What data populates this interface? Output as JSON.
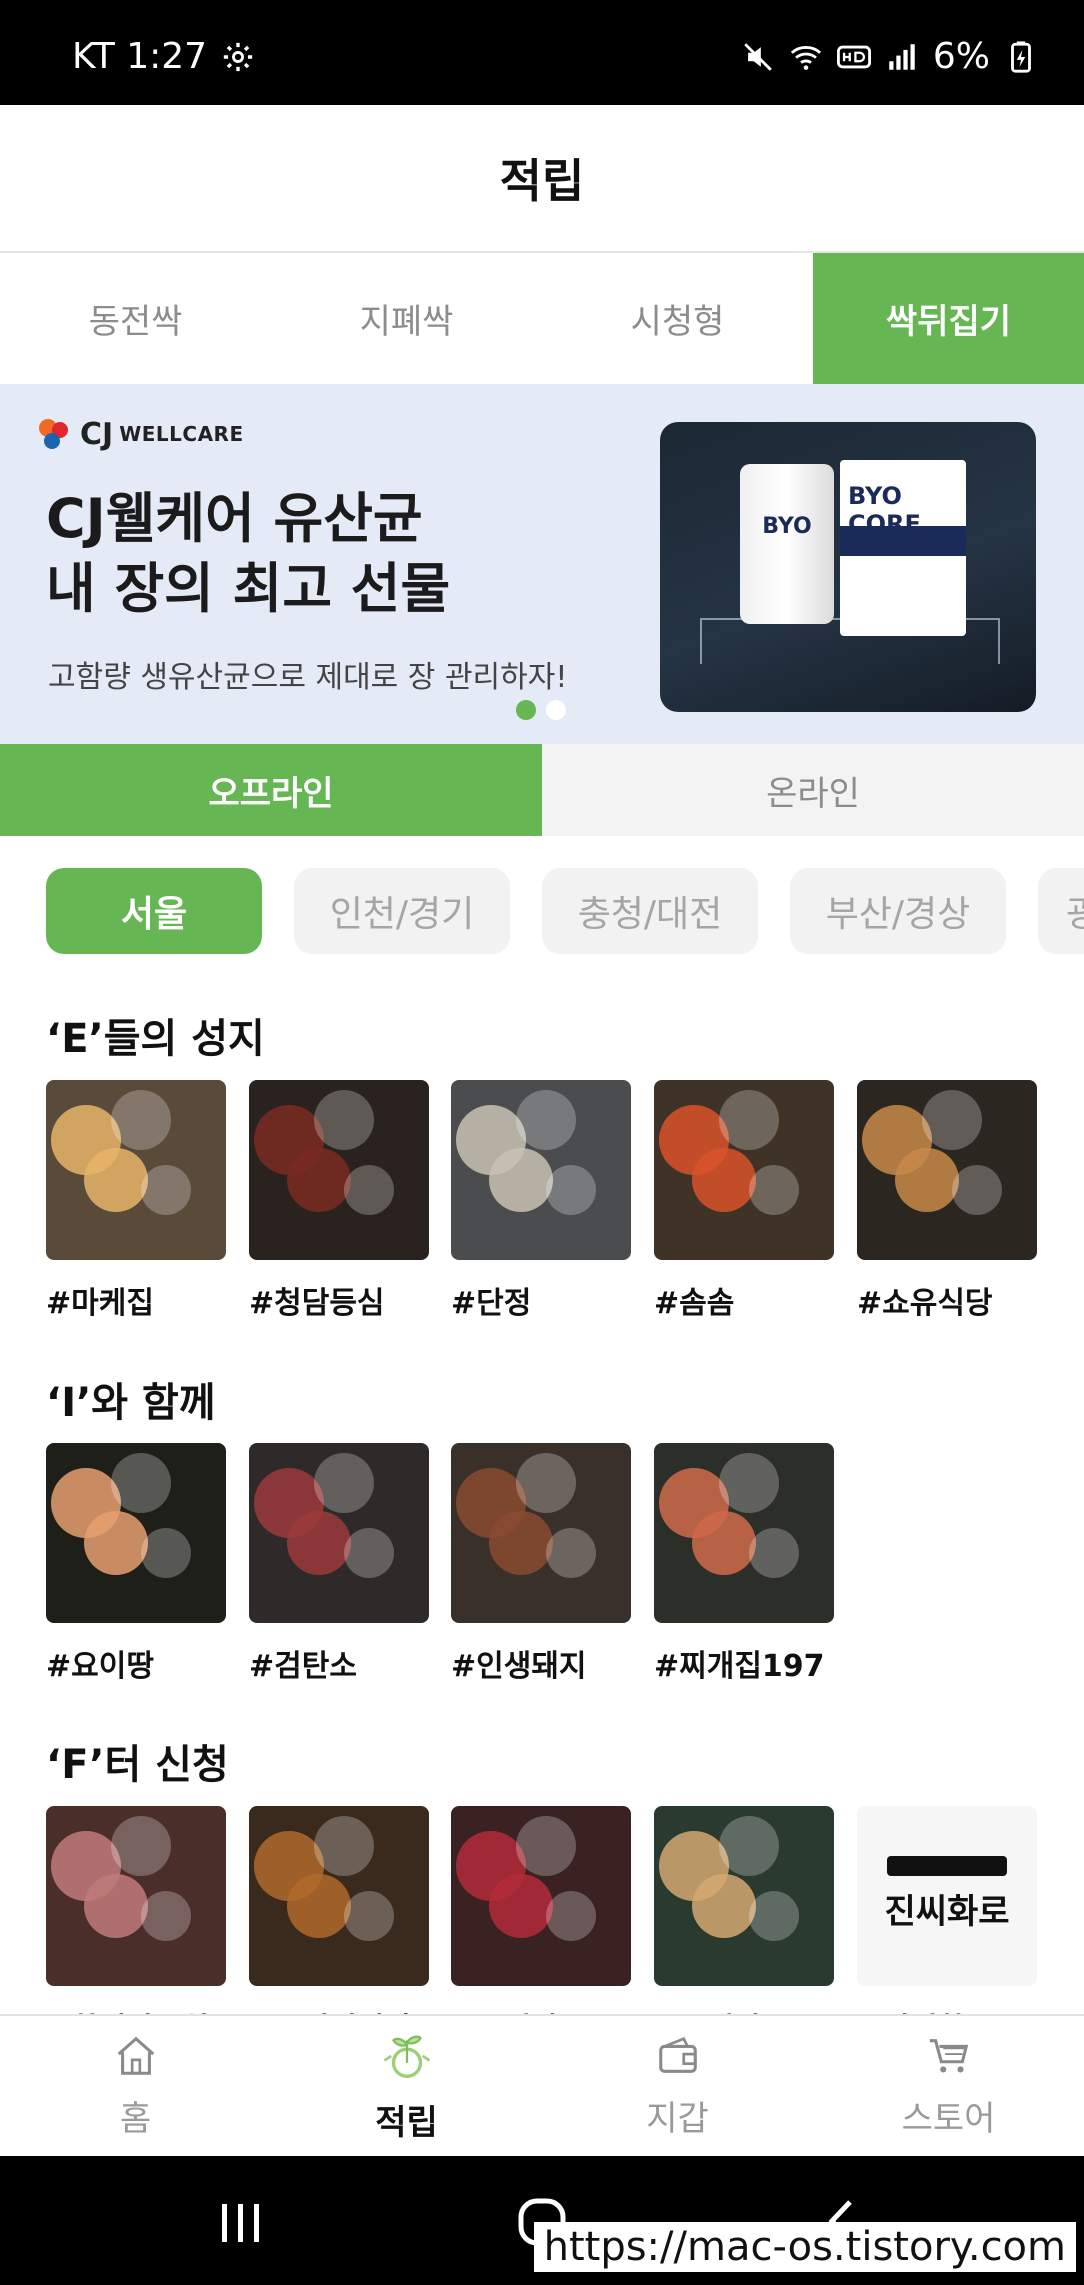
{
  "status_bar": {
    "carrier_time": "KT 1:27",
    "battery": "6%"
  },
  "header": {
    "title": "적립"
  },
  "tabs": [
    {
      "label": "동전싹",
      "active": false
    },
    {
      "label": "지폐싹",
      "active": false
    },
    {
      "label": "시청형",
      "active": false
    },
    {
      "label": "싹뒤집기",
      "active": true
    }
  ],
  "banner": {
    "logo_cj": "CJ",
    "logo_wellcare": "WELLCARE",
    "headline_line1": "CJ웰케어 유산균",
    "headline_line2": "내 장의 최고 선물",
    "subtext": "고함량 생유산균으로 제대로 장 관리하자!",
    "product_bottle_label": "BYO",
    "product_box_label": "BYO CORE"
  },
  "sub_tabs": [
    {
      "label": "오프라인",
      "active": true
    },
    {
      "label": "온라인",
      "active": false
    }
  ],
  "regions": [
    {
      "label": "서울",
      "active": true
    },
    {
      "label": "인천/경기",
      "active": false
    },
    {
      "label": "충청/대전",
      "active": false
    },
    {
      "label": "부산/경상",
      "active": false
    },
    {
      "label": "광",
      "active": false
    }
  ],
  "sections": [
    {
      "title": "‘E’들의 성지",
      "items": [
        {
          "label": "#마케집",
          "bg": "#5a4a3a",
          "accent": "#e8b46a"
        },
        {
          "label": "#청담등심",
          "bg": "#2a221e",
          "accent": "#7a2a22"
        },
        {
          "label": "#단정",
          "bg": "#4a4c4e",
          "accent": "#c9c2b4"
        },
        {
          "label": "#솜솜",
          "bg": "#3e3326",
          "accent": "#d8542a"
        },
        {
          "label": "#쇼유식당",
          "bg": "#2c2620",
          "accent": "#c8894a"
        }
      ]
    },
    {
      "title": "‘I’와 함께",
      "items": [
        {
          "label": "#요이땅",
          "bg": "#1f1f1a",
          "accent": "#e8a070"
        },
        {
          "label": "#검탄소",
          "bg": "#2e2a2a",
          "accent": "#9c3a3a"
        },
        {
          "label": "#인생돼지",
          "bg": "#3a302a",
          "accent": "#8a4a30"
        },
        {
          "label": "#찌개집197",
          "bg": "#2c2e2a",
          "accent": "#d06a4a"
        }
      ]
    },
    {
      "title": "‘F’터 신청",
      "items": [
        {
          "label": "#화서양꼬치",
          "bg": "#4a2e2a",
          "accent": "#c07a7a"
        },
        {
          "label": "#부림전미갈",
          "bg": "#3a2a1e",
          "accent": "#b06a2a"
        },
        {
          "label": "#우시야",
          "bg": "#3a2222",
          "accent": "#b42a3a"
        },
        {
          "label": "#우시야",
          "bg": "#2a3a2e",
          "accent": "#d4a870"
        },
        {
          "label": "#진씨화로",
          "bg": "#f6f6f6",
          "accent": "#111111"
        }
      ]
    }
  ],
  "jinssi_logo_text": "진씨화로",
  "bottom_nav": [
    {
      "label": "홈",
      "icon": "home-icon",
      "active": false
    },
    {
      "label": "적립",
      "icon": "sprout-coin-icon",
      "active": true
    },
    {
      "label": "지갑",
      "icon": "wallet-icon",
      "active": false
    },
    {
      "label": "스토어",
      "icon": "cart-icon",
      "active": false
    }
  ],
  "watermark": "https://mac-os.tistory.com",
  "colors": {
    "brand_green": "#66b653",
    "banner_bg": "#e4ebf6",
    "chip_bg": "#f2f2f2"
  }
}
